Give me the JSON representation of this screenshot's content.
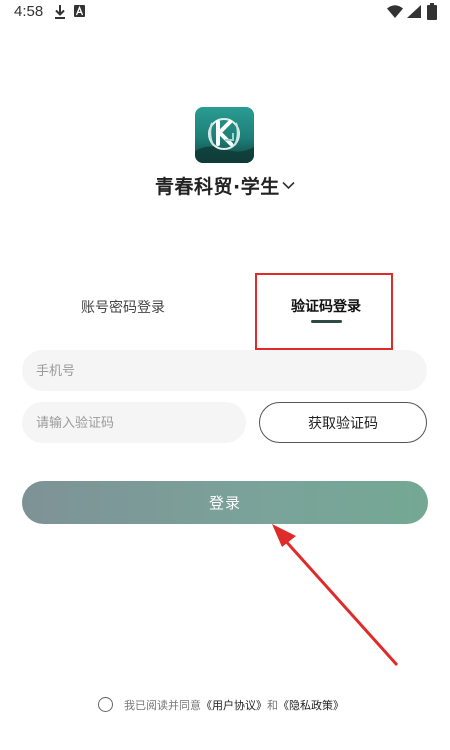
{
  "status_bar": {
    "time": "4:58",
    "icons": [
      "download-icon",
      "a-notification-icon",
      "wifi-icon",
      "signal-icon",
      "battery-icon"
    ]
  },
  "app": {
    "logo_icon": "k-badge-logo",
    "title": "青春科贸·学生",
    "title_chevron_icon": "chevron-down-icon"
  },
  "tabs": [
    {
      "label": "账号密码登录",
      "active": false
    },
    {
      "label": "验证码登录",
      "active": true
    }
  ],
  "form": {
    "phone_placeholder": "手机号",
    "code_placeholder": "请输入验证码",
    "get_code_label": "获取验证码",
    "login_label": "登录"
  },
  "agreement": {
    "prefix": "我已阅读并同意",
    "user_agreement": "《用户协议》",
    "conjunction": "和",
    "privacy_policy": "《隐私政策》"
  },
  "colors": {
    "accent_dark": "#2f4a44",
    "login_gradient_start": "#7e9296",
    "login_gradient_end": "#74a894",
    "annotation_red": "#e02b2b"
  }
}
